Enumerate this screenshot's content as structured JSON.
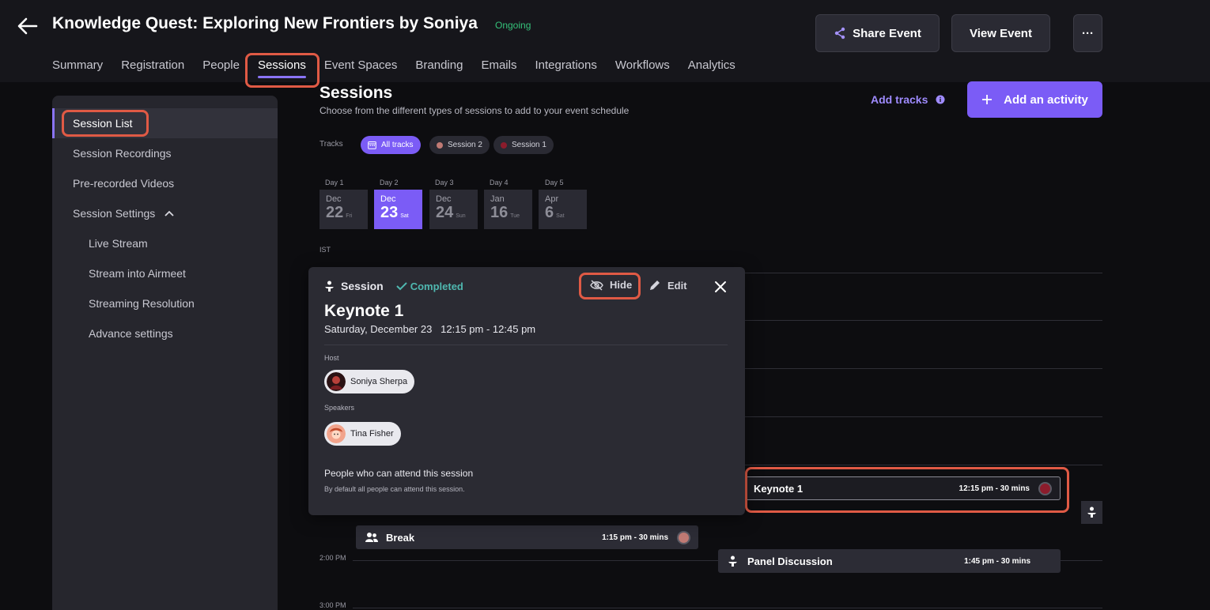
{
  "header": {
    "title": "Knowledge Quest: Exploring New Frontiers by Soniya",
    "status": "Ongoing",
    "share_label": "Share Event",
    "view_label": "View Event",
    "more_label": "···"
  },
  "nav": {
    "tabs": [
      {
        "label": "Summary"
      },
      {
        "label": "Registration"
      },
      {
        "label": "People"
      },
      {
        "label": "Sessions",
        "active": true
      },
      {
        "label": "Event Spaces"
      },
      {
        "label": "Branding"
      },
      {
        "label": "Emails"
      },
      {
        "label": "Integrations"
      },
      {
        "label": "Workflows"
      },
      {
        "label": "Analytics"
      }
    ]
  },
  "sidebar": {
    "items": [
      {
        "label": "Session List",
        "active": true
      },
      {
        "label": "Session Recordings"
      },
      {
        "label": "Pre-recorded Videos"
      },
      {
        "label": "Session Settings",
        "expanded": true
      },
      {
        "label": "Live Stream"
      },
      {
        "label": "Stream into Airmeet"
      },
      {
        "label": "Streaming Resolution"
      },
      {
        "label": "Advance settings"
      }
    ]
  },
  "main": {
    "title": "Sessions",
    "subtitle": "Choose from the different types of sessions to add to your event schedule",
    "add_tracks_label": "Add tracks",
    "add_activity_label": "Add an activity",
    "tracks_label": "Tracks",
    "tracks": [
      {
        "label": "All tracks",
        "active": true
      },
      {
        "label": "Session 2",
        "color": "#c07a74"
      },
      {
        "label": "Session 1",
        "color": "#8c1c2c"
      }
    ],
    "days": [
      {
        "label": "Day 1",
        "month": "Dec",
        "date": "22",
        "weekday": "Fri"
      },
      {
        "label": "Day 2",
        "month": "Dec",
        "date": "23",
        "weekday": "Sat",
        "active": true
      },
      {
        "label": "Day 3",
        "month": "Dec",
        "date": "24",
        "weekday": "Sun"
      },
      {
        "label": "Day 4",
        "month": "Jan",
        "date": "16",
        "weekday": "Tue"
      },
      {
        "label": "Day 5",
        "month": "Apr",
        "date": "6",
        "weekday": "Sat"
      }
    ],
    "timezone": "IST",
    "time_labels": [
      "2:00 PM",
      "3:00 PM"
    ],
    "sessions": [
      {
        "title": "Keynote 1",
        "time": "12:15 pm - 30 mins",
        "color": "#8c1c2c"
      },
      {
        "title": "Break",
        "time": "1:15 pm - 30 mins",
        "color": "#c07a74"
      },
      {
        "title": "Panel Discussion",
        "time": "1:45 pm - 30 mins"
      }
    ]
  },
  "popup": {
    "type_label": "Session",
    "status_label": "Completed",
    "hide_label": "Hide",
    "edit_label": "Edit",
    "title": "Keynote 1",
    "date": "Saturday, December 23   12:15 pm - 12:45 pm",
    "host_label": "Host",
    "host_name": "Soniya Sherpa",
    "speakers_label": "Speakers",
    "speaker_name": "Tina Fisher",
    "attend_title": "People who can attend this session",
    "attend_sub": "By default all people can attend this session."
  },
  "colors": {
    "accent": "#7b5cf6",
    "status_ongoing": "#35c27a",
    "status_completed": "#4fb8b0",
    "highlight": "#e05a45"
  }
}
